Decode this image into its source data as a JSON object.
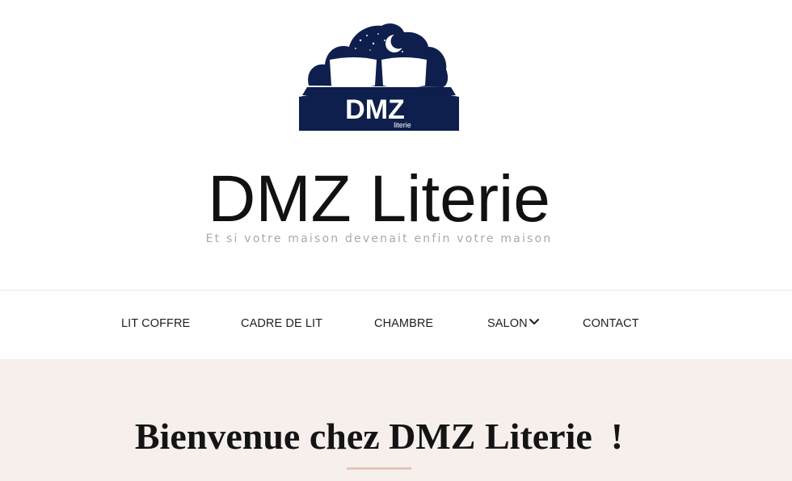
{
  "header": {
    "logo": {
      "brand_text": "DMZ",
      "sub_text": "literie",
      "icon": "bed-night-logo-icon",
      "navy": "#0e1f4d"
    },
    "site_title": "DMZ Literie",
    "tagline": "Et si votre maison devenait enfin votre maison"
  },
  "nav": {
    "items": [
      {
        "label": "LIT COFFRE"
      },
      {
        "label": "CADRE DE LIT"
      },
      {
        "label": "CHAMBRE"
      },
      {
        "label": "SALON",
        "has_dropdown": true,
        "icon": "chevron-down-icon"
      },
      {
        "label": "CONTACT"
      }
    ]
  },
  "hero": {
    "heading": "Bienvenue chez DMZ Literie  !",
    "background": "#f7efec",
    "accent": "#e3c4bd"
  }
}
